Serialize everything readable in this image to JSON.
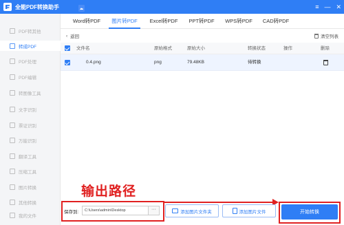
{
  "app": {
    "title": "全能PDF转换助手"
  },
  "window_controls": [
    "≡",
    "—",
    "✕"
  ],
  "sidebar": {
    "items": [
      {
        "label": "PDF转其他",
        "active": false
      },
      {
        "label": "转成PDF",
        "active": true
      },
      {
        "label": "PDF处理",
        "active": false
      },
      {
        "label": "PDF编辑",
        "active": false
      },
      {
        "label": "转图像工具",
        "active": false
      },
      {
        "label": "文字识别",
        "active": false
      },
      {
        "label": "票证识别",
        "active": false
      },
      {
        "label": "万能识别",
        "active": false
      },
      {
        "label": "翻译工具",
        "active": false
      },
      {
        "label": "压缩工具",
        "active": false
      },
      {
        "label": "图片转换",
        "active": false
      },
      {
        "label": "其他转换",
        "active": false
      },
      {
        "label": "我的文件",
        "active": false
      }
    ]
  },
  "tabs": [
    {
      "label": "Word转PDF",
      "active": false
    },
    {
      "label": "图片转PDF",
      "active": true
    },
    {
      "label": "Excel转PDF",
      "active": false
    },
    {
      "label": "PPT转PDF",
      "active": false
    },
    {
      "label": "WPS转PDF",
      "active": false
    },
    {
      "label": "CAD转PDF",
      "active": false
    }
  ],
  "toolbar": {
    "back_label": "返回",
    "clear_label": "清空列表"
  },
  "table": {
    "headers": {
      "name": "文件名",
      "format": "原始格式",
      "size": "原始大小",
      "status": "转换状态",
      "action": "操作",
      "delete": "删除"
    },
    "rows": [
      {
        "name": "0.4.png",
        "format": "png",
        "size": "79.48KB",
        "status": "待转换"
      }
    ]
  },
  "annotation": {
    "text": "输出路径",
    "color": "#e02020"
  },
  "bottom": {
    "save_label": "保存到:",
    "path_value": "C:\\Users\\admin\\Desktop",
    "browse_label": "···",
    "add_folder_label": "添加图片文件夹",
    "add_file_label": "添加图片文件",
    "start_label": "开始转换"
  },
  "colors": {
    "brand": "#2f7ef5",
    "row_selected": "#eef4ff",
    "annotation_red": "#e02020"
  },
  "icons": {
    "logo": "app-logo-icon",
    "back": "chevron-left-icon",
    "clear": "trash-icon",
    "file": "image-file-icon",
    "delete": "trash-icon",
    "add_folder": "folder-icon",
    "add_file": "file-icon"
  }
}
